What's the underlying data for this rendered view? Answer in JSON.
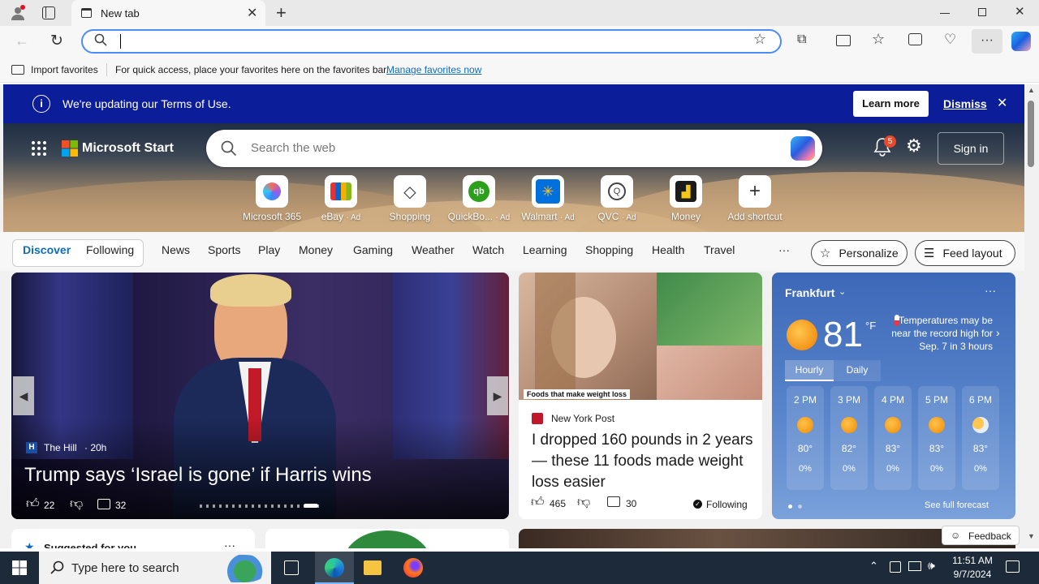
{
  "browser": {
    "tab_title": "New tab",
    "address_value": "",
    "favorites_bar": {
      "import_label": "Import favorites",
      "hint": "For quick access, place your favorites here on the favorites bar.",
      "manage_link": "Manage favorites now"
    }
  },
  "banner": {
    "text": "We're updating our Terms of Use.",
    "learn_more": "Learn more",
    "dismiss": "Dismiss"
  },
  "header": {
    "brand": "Microsoft Start",
    "search_placeholder": "Search the web",
    "notification_count": "5",
    "sign_in": "Sign in"
  },
  "quick_links": [
    {
      "label": "Microsoft 365",
      "ad": ""
    },
    {
      "label": "eBay",
      "ad": "· Ad"
    },
    {
      "label": "Shopping",
      "ad": ""
    },
    {
      "label": "QuickBo...",
      "ad": "· Ad"
    },
    {
      "label": "Walmart",
      "ad": "· Ad"
    },
    {
      "label": "QVC",
      "ad": "· Ad"
    },
    {
      "label": "Money",
      "ad": ""
    },
    {
      "label": "Add shortcut",
      "ad": ""
    }
  ],
  "nav": {
    "discover": "Discover",
    "following": "Following",
    "items": [
      "News",
      "Sports",
      "Play",
      "Money",
      "Gaming",
      "Weather",
      "Watch",
      "Learning",
      "Shopping",
      "Health",
      "Travel"
    ],
    "more": "···",
    "personalize": "Personalize",
    "feed_layout": "Feed layout"
  },
  "main_story": {
    "source": "The Hill",
    "age": "· 20h",
    "headline": "Trump says ‘Israel is gone’ if Harris wins",
    "likes": "22",
    "comments": "32"
  },
  "news_card": {
    "image_caption": "Foods that make weight loss",
    "source": "New York Post",
    "headline": "I dropped 160 pounds in 2 years — these 11 foods made weight loss easier",
    "likes": "465",
    "comments": "30",
    "following": "Following"
  },
  "weather": {
    "city": "Frankfurt",
    "temp": "81",
    "unit": "°F",
    "alert": "Temperatures may be near the record high for Sep. 7 in 3 hours",
    "tab_hourly": "Hourly",
    "tab_daily": "Daily",
    "hours": [
      {
        "time": "2 PM",
        "temp": "80°",
        "precip": "0%"
      },
      {
        "time": "3 PM",
        "temp": "82°",
        "precip": "0%"
      },
      {
        "time": "4 PM",
        "temp": "83°",
        "precip": "0%"
      },
      {
        "time": "5 PM",
        "temp": "83°",
        "precip": "0%"
      },
      {
        "time": "6 PM",
        "temp": "83°",
        "precip": "0%"
      }
    ],
    "full_forecast": "See full forecast"
  },
  "lower": {
    "suggested": "Suggested for you",
    "feedback": "Feedback"
  },
  "taskbar": {
    "search_placeholder": "Type here to search",
    "time": "11:51 AM",
    "date": "9/7/2024"
  },
  "colors": {
    "banner_bg": "#0c1d99",
    "accent": "#0f6cbd",
    "weather_bg": "#5a86cc"
  }
}
